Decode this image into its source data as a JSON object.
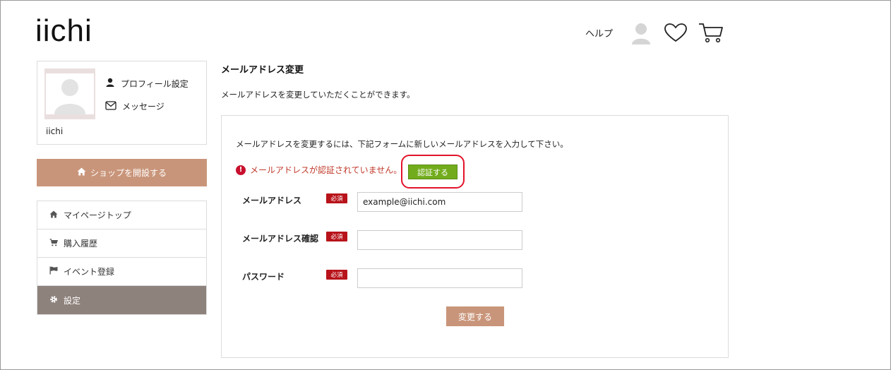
{
  "header": {
    "logo": "iichi",
    "help_label": "ヘルプ"
  },
  "sidebar": {
    "username": "iichi",
    "profile_links": [
      {
        "label": "プロフィール設定",
        "icon": "user-icon"
      },
      {
        "label": "メッセージ",
        "icon": "envelope-icon"
      }
    ],
    "shop_button": "ショップを開設する",
    "menu": [
      {
        "label": "マイページトップ",
        "icon": "home-icon"
      },
      {
        "label": "購入履歴",
        "icon": "cart-icon"
      },
      {
        "label": "イベント登録",
        "icon": "flag-icon"
      },
      {
        "label": "設定",
        "icon": "gear-icon",
        "active": true
      }
    ]
  },
  "main": {
    "title": "メールアドレス変更",
    "description": "メールアドレスを変更していただくことができます。",
    "instruction": "メールアドレスを変更するには、下記フォームに新しいメールアドレスを入力して下さい。",
    "warning": "メールアドレスが認証されていません。",
    "verify_button": "認証する",
    "required_badge": "必須",
    "fields": [
      {
        "label": "メールアドレス",
        "value": "example@iichi.com",
        "placeholder": ""
      },
      {
        "label": "メールアドレス確認",
        "value": "",
        "placeholder": ""
      },
      {
        "label": "パスワード",
        "value": "",
        "placeholder": ""
      }
    ],
    "submit_button": "変更する"
  },
  "colors": {
    "accent": "#c9957a",
    "active_menu": "#8e827d",
    "verify_green": "#72ac1c",
    "required_red": "#b8131a",
    "warning_red": "#c0392b"
  }
}
